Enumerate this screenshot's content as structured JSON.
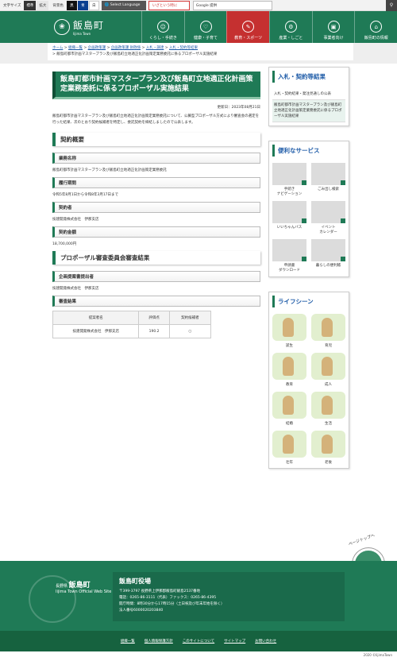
{
  "topbar": {
    "font_size_label": "文字サイズ",
    "standard": "標準",
    "large": "拡大",
    "bg_label": "背景色",
    "bg_black": "黒",
    "bg_blue": "青",
    "bg_white": "白",
    "lang_select": "Select Language",
    "emergency": "いざという時に",
    "search_placeholder": "Google 提供",
    "search_button_icon": "magnifier-icon"
  },
  "header": {
    "logo_title": "飯島町",
    "logo_sub": "Iijima Town",
    "nav": [
      {
        "label": "くらし・手続き",
        "icon": "person-icon"
      },
      {
        "label": "健康・子育て",
        "icon": "heart-icon"
      },
      {
        "label": "教育・スポーツ",
        "icon": "book-icon"
      },
      {
        "label": "産業・しごと",
        "icon": "factory-icon"
      },
      {
        "label": "事業者向け",
        "icon": "briefcase-icon"
      },
      {
        "label": "飯島町の情報",
        "icon": "building-icon"
      }
    ]
  },
  "breadcrumb": {
    "items": [
      "ホーム",
      "組織一覧",
      "企画政策課",
      "企画政策課 財政係",
      "入札・調達",
      "入札・契約等結果"
    ],
    "current": "飯島町都市計画マスタープラン及び飯島町立地適正化計画策定業務委託に係るプロポーザル実施結果"
  },
  "article": {
    "title": "飯島町都市計画マスタープラン及び飯島町立地適正化計画策定業務委託に係るプロポーザル実施結果",
    "updated": "更新日：2023年08月21日",
    "intro": "飯島町都市計画マスタープラン及び飯島町立地適正化計画策定業務委託について、公募型プロポーザル方式により審査会の選定を行った結果、次のとおり契約候補者を特定し、委託契約を締結しましたので公表します。",
    "section1": "契約概要",
    "name_label": "業務名称",
    "name_value": "飯島町都市計画マスタープラン及び飯島町立地適正化計画策定業務委託",
    "period_label": "履行期間",
    "period_value": "令和5年8月1日から令和8年3月17日まで",
    "party_label": "契約者",
    "party_value": "技建開発株式会社　伊那支店",
    "amount_label": "契約金額",
    "amount_value": "18,700,000円",
    "section2": "プロポーザル審査委員会審査結果",
    "submitter_label": "企画提案書提出者",
    "submitter_value": "技建開発株式会社　伊那支店",
    "result_label": "審査結果",
    "table_headers": [
      "提案者名",
      "評価点",
      "契約候補者"
    ],
    "table_row": [
      "技建開発株式会社　伊那支店",
      "190.2",
      "○"
    ]
  },
  "sidebar": {
    "nyusatsu_title": "入札・契約等結果",
    "nyusatsu_links": [
      "入札・契約結果・発注見通しの公表",
      "飯島町都市計画マスタープラン及び飯島町立地適正化計画策定業務委託に係るプロポーザル実施結果"
    ],
    "services_title": "便利なサービス",
    "services": [
      "手続き\nナビゲーション",
      "ごみ出し検索",
      "いいちゃんバス",
      "イベント\nカレンダー",
      "申請書\nダウンロード",
      "暮らしの便利帳"
    ],
    "life_title": "ライフシーン",
    "life": [
      "誕生",
      "育児",
      "教育",
      "成人",
      "結婚",
      "生活",
      "壮年",
      "老後"
    ]
  },
  "footer": {
    "logo_pref": "長野県",
    "logo_name": "飯島町",
    "logo_sub": "Iijima Town Official Web Site",
    "office": "飯島町役場",
    "address": "〒399-3797 長野県上伊那郡飯島町飯島2537番地",
    "tel": "電話：0265-86-3111（代表）ファックス：0265-86-4395",
    "hours": "開庁時間：8時30分から17時15分（土日祝及び年末年始を除く）",
    "corp_no": "法人番号6000020203840",
    "links": [
      "組織一覧",
      "個人情報保護方針",
      "このサイトについて",
      "サイトマップ",
      "お問い合わせ"
    ],
    "copyright": "2020 ©IijimaTown",
    "pagetop": "ページトップへ"
  }
}
